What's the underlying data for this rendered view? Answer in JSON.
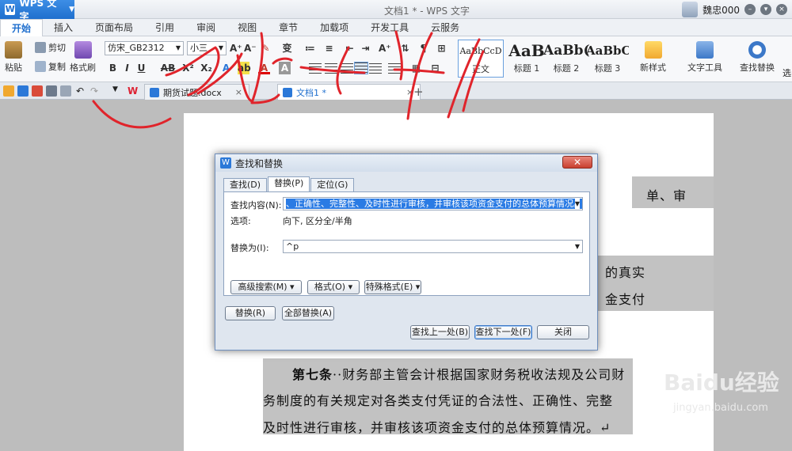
{
  "titlebar": {
    "app_name": "WPS 文字",
    "doc_title": "文档1 * - WPS 文字",
    "user_name": "魏忠000",
    "win_buttons": [
      "min",
      "max",
      "close"
    ]
  },
  "ribbon_tabs": [
    "开始",
    "插入",
    "页面布局",
    "引用",
    "审阅",
    "视图",
    "章节",
    "加载项",
    "开发工具",
    "云服务"
  ],
  "ribbon": {
    "paste_label": "粘贴",
    "cut_label": "剪切",
    "copy_label": "复制",
    "format_painter_label": "格式刷",
    "font_name": "仿宋_GB2312",
    "font_size": "小三",
    "styles": [
      {
        "sample": "AaBbCcD",
        "name": "正文"
      },
      {
        "sample": "AaB",
        "name": "标题 1"
      },
      {
        "sample": "AaBb(",
        "name": "标题 2"
      },
      {
        "sample": "AaBbC",
        "name": "标题 3"
      }
    ],
    "new_style_label": "新样式",
    "text_tools_label": "文字工具",
    "find_replace_label": "查找替换",
    "select_label": "选"
  },
  "doc_tabs": [
    {
      "label": "期货试题.docx",
      "active": false
    },
    {
      "label": "文档1 *",
      "active": true
    }
  ],
  "document": {
    "top_right_fragment": "单、审",
    "mid_fragment_1": "的真实",
    "mid_fragment_2": "金支付",
    "article_head": "第七条",
    "line1": "··财务部主管会计根据国家财务税收法规及公司财",
    "line2": "务制度的有关规定对各类支付凭证的合法性、正确性、完整",
    "line3": "及时性进行审核，并审核该项资金支付的总体预算情况。↵"
  },
  "dialog": {
    "title": "查找和替换",
    "close_label": "✕",
    "tabs": [
      "查找(D)",
      "替换(P)",
      "定位(G)"
    ],
    "active_tab": 1,
    "find_label": "查找内容(N):",
    "find_value": "、正确性、完整性、及时性进行审核，并审核该项资金支付的总体预算情况。^p",
    "options_label": "选项:",
    "options_value": "向下, 区分全/半角",
    "replace_label": "替换为(I):",
    "replace_value": "^p",
    "advanced_search": "高级搜索(M) ▾",
    "format": "格式(O) ▾",
    "special_format": "特殊格式(E) ▾",
    "replace_btn": "替换(R)",
    "replace_all_btn": "全部替换(A)",
    "find_prev_btn": "查找上一处(B)",
    "find_next_btn": "查找下一处(F)",
    "close_btn": "关闭"
  },
  "watermark": {
    "text": "Baidu经验",
    "url": "jingyan.baidu.com"
  },
  "colors": {
    "accent": "#1f6fce",
    "selection": "#2a7be4",
    "scribble": "#e0242b",
    "page_highlight": "#c2c2c2"
  }
}
